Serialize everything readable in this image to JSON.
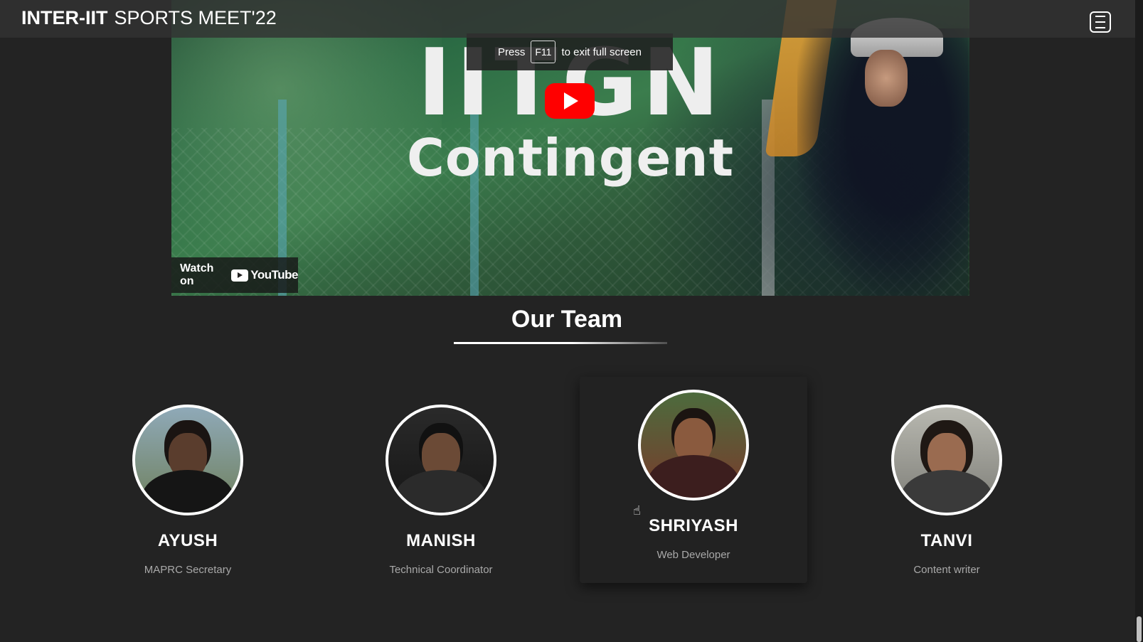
{
  "navbar": {
    "brand_bold": "INTER-IIT",
    "brand_light": "SPORTS MEET'22",
    "menu_icon": "hamburger-menu-icon"
  },
  "video": {
    "title_line1": "IITGN",
    "title_line2": "Contingent",
    "watch_on_label": "Watch on",
    "youtube_label": "YouTube",
    "play_icon": "play-icon"
  },
  "fullscreen_toast": {
    "prefix": "Press",
    "key": "F11",
    "suffix": "to exit full screen"
  },
  "team": {
    "heading": "Our Team",
    "members": [
      {
        "name": "AYUSH",
        "role": "MAPRC Secretary"
      },
      {
        "name": "MANISH",
        "role": "Technical Coordinator"
      },
      {
        "name": "SHRIYASH",
        "role": "Web Developer"
      },
      {
        "name": "TANVI",
        "role": "Content writer"
      }
    ]
  },
  "colors": {
    "background": "#232323",
    "youtube_red": "#ff0000",
    "role_text": "#a9a9a9"
  }
}
